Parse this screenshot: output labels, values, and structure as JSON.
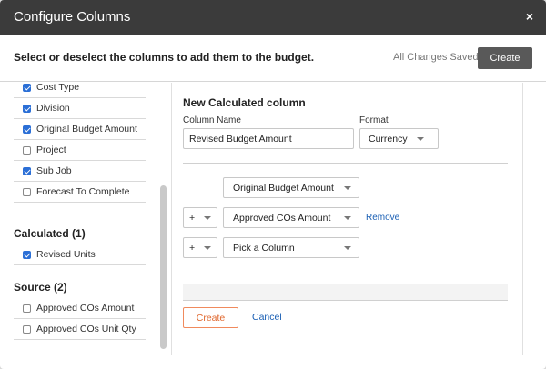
{
  "dialog": {
    "title": "Configure Columns",
    "close_icon": "×"
  },
  "header": {
    "instruction": "Select or deselect the columns to add them to the budget.",
    "status": "All Changes Saved",
    "create_label": "Create"
  },
  "columns": {
    "items": [
      {
        "label": "Cost Type",
        "checked": true
      },
      {
        "label": "Division",
        "checked": true
      },
      {
        "label": "Original Budget Amount",
        "checked": true
      },
      {
        "label": "Project",
        "checked": false
      },
      {
        "label": "Sub Job",
        "checked": true
      },
      {
        "label": "Forecast To Complete",
        "checked": false
      }
    ],
    "calculated": {
      "heading": "Calculated (1)",
      "items": [
        {
          "label": "Revised Units",
          "checked": true
        }
      ]
    },
    "source": {
      "heading": "Source (2)",
      "items": [
        {
          "label": "Approved COs Amount",
          "checked": false
        },
        {
          "label": "Approved COs Unit Qty",
          "checked": false
        }
      ]
    }
  },
  "calc_form": {
    "title": "New Calculated column",
    "column_name_label": "Column Name",
    "column_name_value": "Revised Budget Amount",
    "format_label": "Format",
    "format_value": "Currency",
    "formula": [
      {
        "operator": "",
        "column": "Original Budget Amount"
      },
      {
        "operator": "+",
        "column": "Approved COs Amount",
        "action": "Remove"
      },
      {
        "operator": "+",
        "column": "Pick a Column"
      }
    ],
    "create_label": "Create",
    "cancel_label": "Cancel"
  }
}
